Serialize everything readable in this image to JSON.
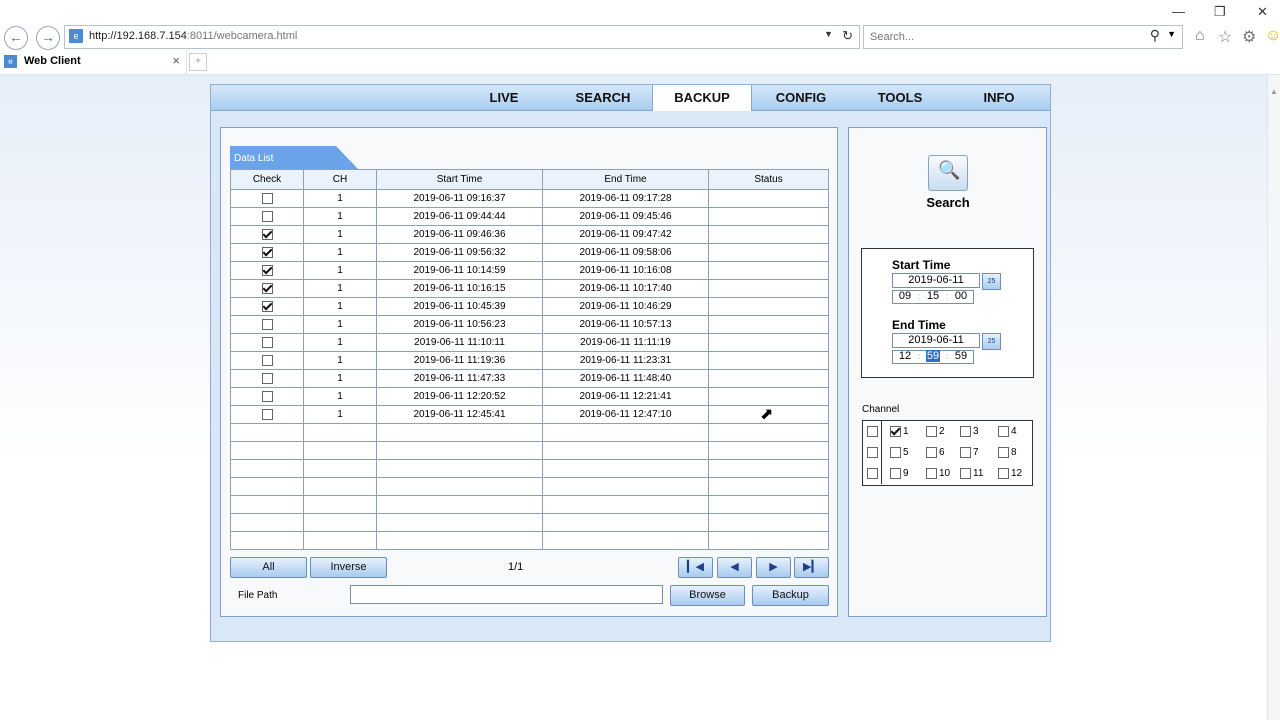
{
  "browser": {
    "url_host": "http://192.168.7.154",
    "url_port_path": ":8011/webcamera.html",
    "search_placeholder": "Search...",
    "tab_title": "Web Client",
    "controls": {
      "minimize": "—",
      "restore": "❐",
      "close": "✕"
    }
  },
  "nav": {
    "menus": [
      "LIVE",
      "SEARCH",
      "BACKUP",
      "CONFIG",
      "TOOLS",
      "INFO"
    ],
    "active": "BACKUP"
  },
  "data_list": {
    "tab_label": "Data List",
    "columns": [
      "Check",
      "CH",
      "Start Time",
      "End Time",
      "Status"
    ],
    "rows": [
      {
        "checked": false,
        "ch": "1",
        "start": "2019-06-11 09:16:37",
        "end": "2019-06-11 09:17:28",
        "status": ""
      },
      {
        "checked": false,
        "ch": "1",
        "start": "2019-06-11 09:44:44",
        "end": "2019-06-11 09:45:46",
        "status": ""
      },
      {
        "checked": true,
        "ch": "1",
        "start": "2019-06-11 09:46:36",
        "end": "2019-06-11 09:47:42",
        "status": ""
      },
      {
        "checked": true,
        "ch": "1",
        "start": "2019-06-11 09:56:32",
        "end": "2019-06-11 09:58:06",
        "status": ""
      },
      {
        "checked": true,
        "ch": "1",
        "start": "2019-06-11 10:14:59",
        "end": "2019-06-11 10:16:08",
        "status": ""
      },
      {
        "checked": true,
        "ch": "1",
        "start": "2019-06-11 10:16:15",
        "end": "2019-06-11 10:17:40",
        "status": ""
      },
      {
        "checked": true,
        "ch": "1",
        "start": "2019-06-11 10:45:39",
        "end": "2019-06-11 10:46:29",
        "status": ""
      },
      {
        "checked": false,
        "ch": "1",
        "start": "2019-06-11 10:56:23",
        "end": "2019-06-11 10:57:13",
        "status": ""
      },
      {
        "checked": false,
        "ch": "1",
        "start": "2019-06-11 11:10:11",
        "end": "2019-06-11 11:11:19",
        "status": ""
      },
      {
        "checked": false,
        "ch": "1",
        "start": "2019-06-11 11:19:36",
        "end": "2019-06-11 11:23:31",
        "status": ""
      },
      {
        "checked": false,
        "ch": "1",
        "start": "2019-06-11 11:47:33",
        "end": "2019-06-11 11:48:40",
        "status": ""
      },
      {
        "checked": false,
        "ch": "1",
        "start": "2019-06-11 12:20:52",
        "end": "2019-06-11 12:21:41",
        "status": ""
      },
      {
        "checked": false,
        "ch": "1",
        "start": "2019-06-11 12:45:41",
        "end": "2019-06-11 12:47:10",
        "status": ""
      }
    ],
    "empty_rows": 7,
    "all_label": "All",
    "inverse_label": "Inverse",
    "page": "1/1",
    "file_path_label": "File Path",
    "file_path_value": "",
    "browse_label": "Browse",
    "backup_label": "Backup"
  },
  "search_panel": {
    "title": "Search",
    "start_label": "Start Time",
    "start_date": "2019-06-11",
    "start_h": "09",
    "start_m": "15",
    "start_s": "00",
    "end_label": "End Time",
    "end_date": "2019-06-11",
    "end_h": "12",
    "end_m": "59",
    "end_s": "59",
    "cal_label": "25",
    "channel_label": "Channel",
    "channels": [
      {
        "n": "1",
        "checked": true
      },
      {
        "n": "2",
        "checked": false
      },
      {
        "n": "3",
        "checked": false
      },
      {
        "n": "4",
        "checked": false
      },
      {
        "n": "5",
        "checked": false
      },
      {
        "n": "6",
        "checked": false
      },
      {
        "n": "7",
        "checked": false
      },
      {
        "n": "8",
        "checked": false
      },
      {
        "n": "9",
        "checked": false
      },
      {
        "n": "10",
        "checked": false
      },
      {
        "n": "11",
        "checked": false
      },
      {
        "n": "12",
        "checked": false
      }
    ]
  },
  "colors": {
    "accent": "#6aa3e8",
    "panel_bg": "#d8e8f7",
    "selected": "#2f6fc4"
  }
}
